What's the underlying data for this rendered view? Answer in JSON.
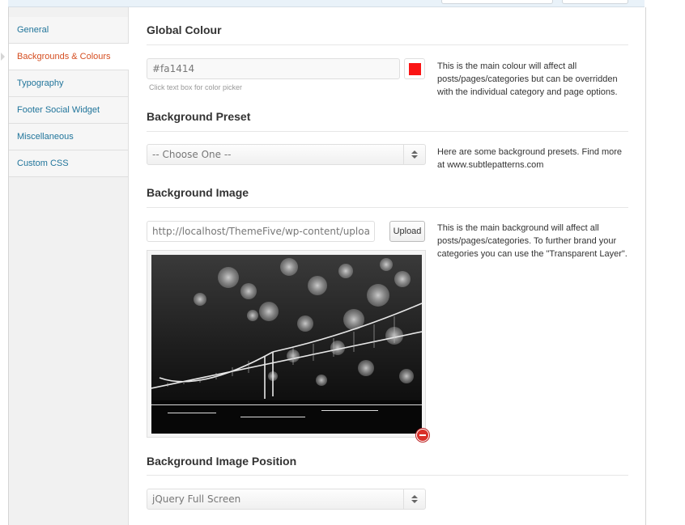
{
  "sidebar": {
    "items": [
      {
        "label": "General"
      },
      {
        "label": "Backgrounds & Colours"
      },
      {
        "label": "Typography"
      },
      {
        "label": "Footer Social Widget"
      },
      {
        "label": "Miscellaneous"
      },
      {
        "label": "Custom CSS"
      }
    ],
    "active_index": 1
  },
  "sections": {
    "global_colour": {
      "title": "Global Colour",
      "value": "#fa1414",
      "swatch_color": "#fa1414",
      "hint": "Click text box for color picker",
      "description": "This is the main colour will affect all posts/pages/categories but can be overridden with the individual category and page options."
    },
    "background_preset": {
      "title": "Background Preset",
      "selected": "-- Choose One --",
      "description": "Here are some background presets. Find more at www.subtlepatterns.com"
    },
    "background_image": {
      "title": "Background Image",
      "url_value": "http://localhost/ThemeFive/wp-content/uploa",
      "upload_label": "Upload",
      "description": "This is the main background will affect all posts/pages/categories. To further brand your categories you can use the \"Transparent Layer\"."
    },
    "background_image_position": {
      "title": "Background Image Position",
      "selected": "jQuery Full Screen"
    }
  },
  "colors": {
    "link": "#21759b",
    "active": "#d54e21",
    "remove": "#d9302a"
  }
}
